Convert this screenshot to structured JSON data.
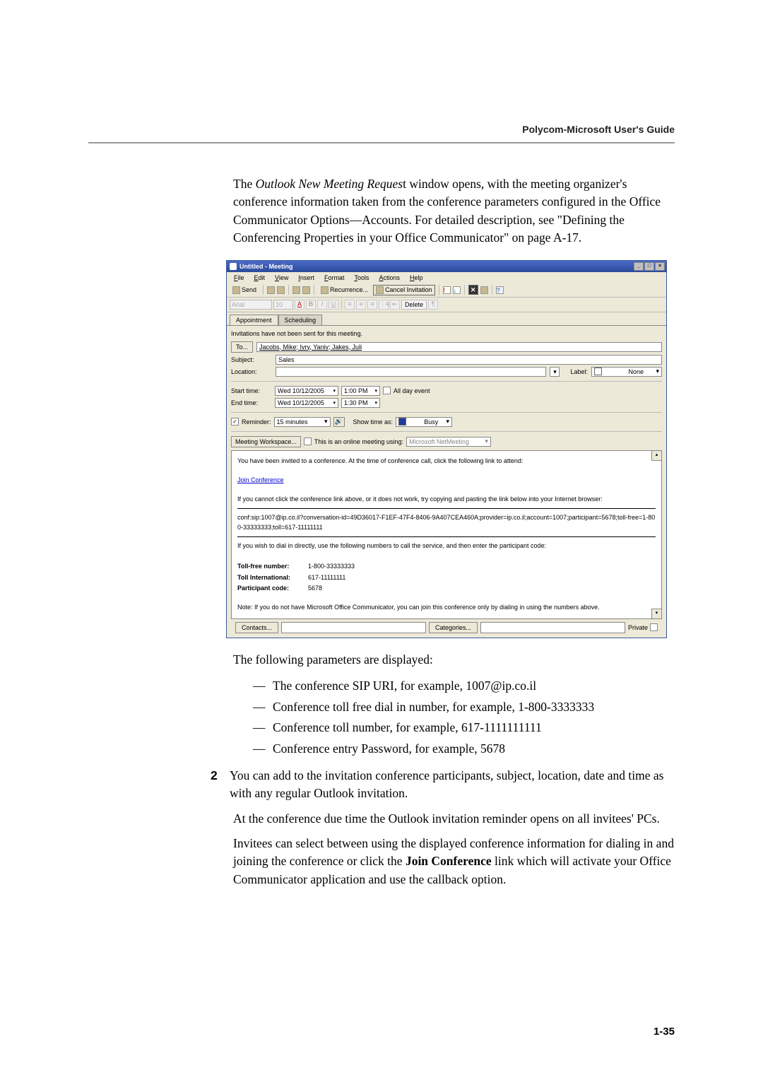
{
  "header": {
    "title": "Polycom-Microsoft User's Guide"
  },
  "main_para": {
    "line1_pre": "The ",
    "line1_italic": "Outlook New Meeting Reques",
    "line1_post": "t window opens, with the meeting organizer's conference information taken from the conference parameters configured in the Office Communicator Options—Accounts. For detailed description, see \"Defining the Conferencing Properties in your Office Communicator\" on page A-17."
  },
  "screenshot": {
    "title": "Untitled - Meeting",
    "menu": {
      "file": "File",
      "edit": "Edit",
      "view": "View",
      "insert": "Insert",
      "format": "Format",
      "tools": "Tools",
      "actions": "Actions",
      "help": "Help"
    },
    "toolbar": {
      "send": "Send",
      "recurrence": "Recurrence...",
      "cancel_invitation": "Cancel Invitation",
      "delete": "Delete"
    },
    "font_toolbar": {
      "font": "Arial",
      "size": "10"
    },
    "tabs": {
      "appointment": "Appointment",
      "scheduling": "Scheduling"
    },
    "notice": "Invitations have not been sent for this meeting.",
    "fields": {
      "to_label": "To...",
      "to_value": "Jacobs, Mike; Ivry, Yaniv; Jakes, Juli",
      "subject_label": "Subject:",
      "subject_value": "Sales",
      "location_label": "Location:",
      "location_value": "",
      "label_label": "Label:",
      "label_value": "None",
      "start_label": "Start time:",
      "start_date": "Wed 10/12/2005",
      "start_time": "1:00 PM",
      "allday": "All day event",
      "end_label": "End time:",
      "end_date": "Wed 10/12/2005",
      "end_time": "1:30 PM",
      "reminder_label": "Reminder:",
      "reminder_value": "15 minutes",
      "showtimeas_label": "Show time as:",
      "showtimeas_value": "Busy",
      "meeting_workspace": "Meeting Workspace...",
      "online_meeting": "This is an online meeting using:",
      "online_meeting_value": "Microsoft NetMeeting"
    },
    "body": {
      "line1": "You have been invited to a conference. At the time of conference call, click the following link to attend:",
      "join_link": "Join Conference",
      "line2": "If you cannot click the conference link above, or it does not work, try copying and pasting the link below into your Internet browser:",
      "conf_uri": "conf:sip:1007@ip.co.il?conversation-id=49D36017-F1EF-47F4-8406-9A407CEA460A;provider=ip.co.il;account=1007;participant=5678;toll-free=1-800-33333333;toll=617-11111111",
      "line3": "If you wish to dial in directly, use the following numbers to call the service, and then enter the participant code:",
      "tollfree_lbl": "Toll-free number:",
      "tollfree_val": "1-800-33333333",
      "tollintl_lbl": "Toll International:",
      "tollintl_val": "617-11111111",
      "pcode_lbl": "Participant code:",
      "pcode_val": "5678",
      "note": "Note: If you do not have Microsoft Office Communicator, you can join this conference only by dialing in using the numbers above."
    },
    "footer": {
      "contacts": "Contacts...",
      "categories": "Categories...",
      "private": "Private"
    }
  },
  "after": {
    "intro": "The following parameters are displayed:",
    "bullets": {
      "b1": "The conference SIP URI, for example, 1007@ip.co.il",
      "b2": "Conference toll free dial in number, for example, 1-800-3333333",
      "b3": "Conference toll number, for example, 617-1111111111",
      "b4": "Conference entry Password, for example, 5678"
    },
    "step2_num": "2",
    "step2_text": "You can add to the invitation conference participants, subject, location, date and time as with any regular Outlook invitation.",
    "p3": "At the conference due time the Outlook invitation reminder opens on all invitees' PCs.",
    "p4_pre": "Invitees can select between using the displayed conference information for dialing in and joining the conference or click the ",
    "p4_bold": "Join Conference",
    "p4_post": " link which will activate your Office Communicator application and use the callback option."
  },
  "page_number": "1-35"
}
